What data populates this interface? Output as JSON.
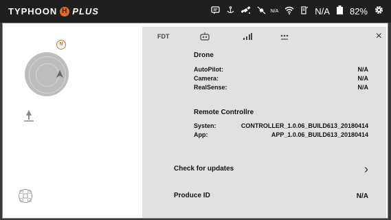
{
  "topbar": {
    "brand_left": "TYPHOON",
    "brand_h": "H",
    "brand_right": "PLUS",
    "signal_na_label": "N/A",
    "status_value": "N/A",
    "battery": "82%"
  },
  "map": {
    "north_label": "N"
  },
  "panel": {
    "drone": {
      "title": "Drone",
      "rows": [
        {
          "label": "AutoPilot:",
          "value": "N/A"
        },
        {
          "label": "Camera:",
          "value": "N/A"
        },
        {
          "label": "RealSense:",
          "value": "N/A"
        }
      ]
    },
    "remote": {
      "title": "Remote Controllre",
      "system_label": "Systen:",
      "system_value": "CONTROLLER_1.0.06_BUILD613_20180414",
      "app_label": "App:",
      "app_value": "APP_1.0.06_BUILD613_20180414"
    },
    "updates_label": "Check for updates",
    "produce_label": "Produce ID",
    "produce_value": "N/A",
    "close_symbol": "×",
    "chevron_symbol": "›"
  }
}
